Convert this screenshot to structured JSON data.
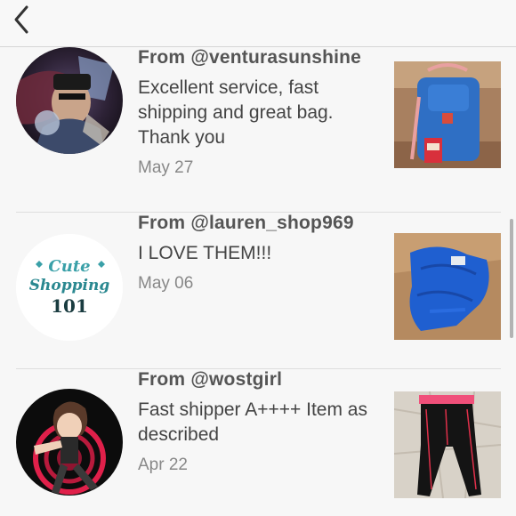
{
  "icons": {
    "back": "chevron-left-icon"
  },
  "reviews": [
    {
      "from": "From @venturasunshine",
      "comment": "Excellent service, fast shipping and great bag. Thank you",
      "date": "May 27"
    },
    {
      "from": "From @lauren_shop969",
      "comment": "I LOVE THEM!!!",
      "date": "May 06",
      "avatar_text": [
        "Cute",
        "Shopping",
        "101"
      ]
    },
    {
      "from": "From @wostgirl",
      "comment": "Fast shipper A++++ Item as described",
      "date": "Apr 22"
    }
  ],
  "colors": {
    "background": "#f7f7f7",
    "divider": "#dedede",
    "text_primary": "#555555",
    "text_secondary": "#888888"
  }
}
